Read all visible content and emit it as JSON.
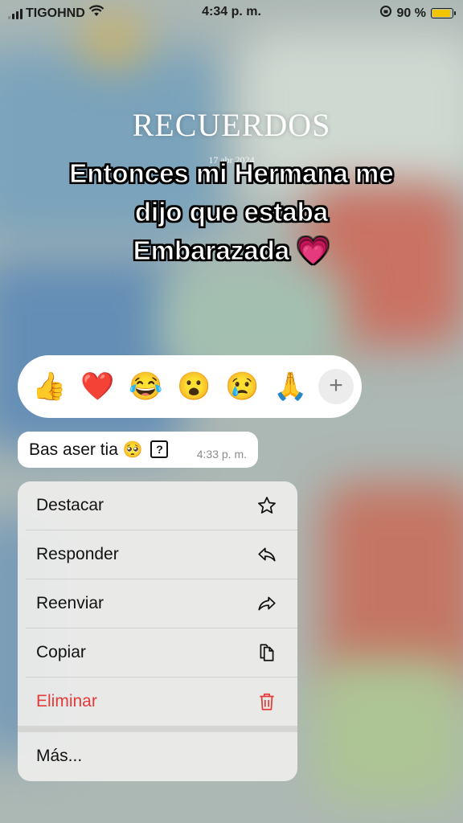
{
  "status_bar": {
    "carrier": "TIGOHND",
    "time": "4:34 p. m.",
    "battery_percent": "90 %",
    "battery_level": 0.9,
    "icons": [
      "signal-icon",
      "wifi-icon",
      "orientation-lock-icon",
      "battery-icon"
    ]
  },
  "overlay": {
    "title": "RECUERDOS",
    "date": "17 abr 2024",
    "caption_lines": [
      "Entonces mi Hermana me",
      "dijo que estaba",
      "Embarazada 💗"
    ]
  },
  "reactions": {
    "items": [
      "👍",
      "❤️",
      "😂",
      "😮",
      "😢",
      "🙏"
    ],
    "more_label": "+"
  },
  "message": {
    "text": "Bas aser tia",
    "emoji": "🥺",
    "unknown_glyph": "?",
    "time": "4:33 p. m."
  },
  "menu": {
    "items": [
      {
        "label": "Destacar",
        "icon": "star-icon"
      },
      {
        "label": "Responder",
        "icon": "reply-icon"
      },
      {
        "label": "Reenviar",
        "icon": "forward-icon"
      },
      {
        "label": "Copiar",
        "icon": "copy-icon"
      },
      {
        "label": "Eliminar",
        "icon": "trash-icon",
        "destructive_color": "#e53a3a"
      },
      {
        "label": "Más...",
        "icon": ""
      }
    ]
  }
}
